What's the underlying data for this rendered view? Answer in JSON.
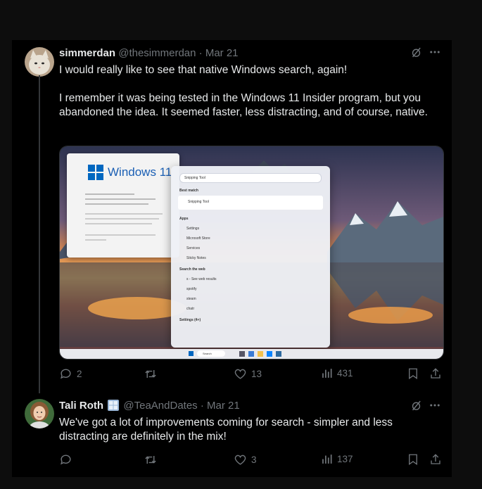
{
  "tweets": [
    {
      "display_name": "simmerdan",
      "handle": "@thesimmerdan",
      "separator": "·",
      "date": "Mar 21",
      "paragraphs": [
        "I would really like to see that native Windows search, again!",
        "I remember it was being tested in the Windows 11 Insider program, but you abandoned the idea. It seemed faster, less distracting, and of course, native."
      ],
      "actions": {
        "replies": "2",
        "retweets": "",
        "likes": "13",
        "views": "431"
      }
    },
    {
      "display_name": "Tali Roth",
      "handle": "@TeaAndDates",
      "separator": "·",
      "date": "Mar 21",
      "paragraphs": [
        "We've got a lot of improvements coming for search - simpler and less distracting are definitely in the mix!"
      ],
      "actions": {
        "replies": "",
        "retweets": "",
        "likes": "3",
        "views": "137"
      }
    }
  ],
  "screenshot": {
    "windows_logo_text": "Windows 11",
    "search_placeholder": "Snipping Tool",
    "best_match_header": "Best match",
    "best_match_item": "Snipping Tool",
    "apps_header": "Apps",
    "apps": [
      "Settings",
      "Microsoft Store",
      "Services",
      "Sticky Notes"
    ],
    "web_header": "Search the web",
    "web_items": [
      "s - See web results",
      "spotify",
      "steam",
      "chatr"
    ],
    "settings_footer": "Settings (4+)",
    "taskbar_search": "Search"
  },
  "colors": {
    "background": "#000000",
    "text_primary": "#e7e9ea",
    "text_secondary": "#71767b",
    "divider": "#2f3336",
    "windows_blue": "#0067c0"
  },
  "icons": [
    "grok-icon",
    "more-icon",
    "reply-icon",
    "retweet-icon",
    "like-icon",
    "views-icon",
    "bookmark-icon",
    "share-icon",
    "windows-flag-icon"
  ]
}
